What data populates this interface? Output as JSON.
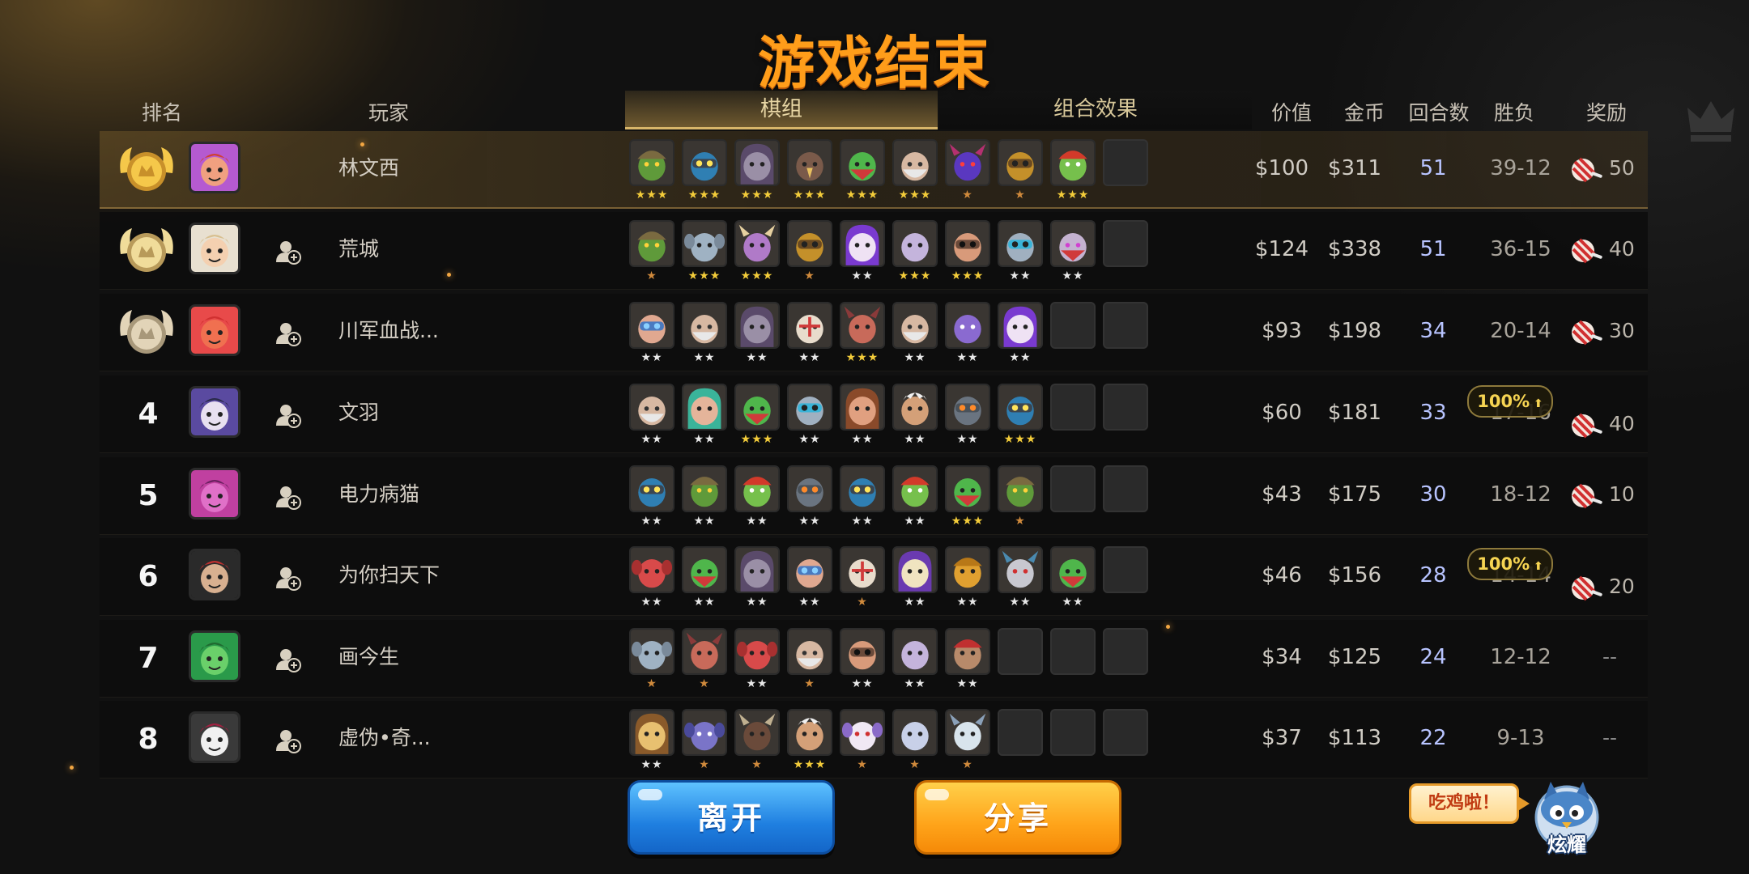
{
  "title": "游戏结束",
  "headers": {
    "rank": "排名",
    "player": "玩家",
    "lineup_tab": "棋组",
    "synergy_tab": "组合效果",
    "value": "价值",
    "gold": "金币",
    "rounds": "回合数",
    "win_loss": "胜负",
    "reward": "奖励"
  },
  "players": [
    {
      "rank": "1",
      "name": "林文西",
      "value": "$100",
      "gold": "$311",
      "rounds": "51",
      "win_loss": "39-12",
      "reward_count": "50",
      "bonus": "",
      "units": [
        {
          "face": "goblin-helm",
          "stars": 3
        },
        {
          "face": "robot-goblin",
          "stars": 3
        },
        {
          "face": "hooded-grey",
          "stars": 3
        },
        {
          "face": "eagle",
          "stars": 3
        },
        {
          "face": "green-bandit",
          "stars": 3
        },
        {
          "face": "old-white",
          "stars": 3
        },
        {
          "face": "purple-horn",
          "stars": 1
        },
        {
          "face": "owl-goggles",
          "stars": 1
        },
        {
          "face": "green-redcap",
          "stars": 3
        },
        {
          "face": "empty",
          "stars": 0
        }
      ]
    },
    {
      "rank": "2",
      "name": "荒城",
      "value": "$124",
      "gold": "$338",
      "rounds": "51",
      "win_loss": "36-15",
      "reward_count": "40",
      "bonus": "",
      "units": [
        {
          "face": "goblin-helm",
          "stars": 1
        },
        {
          "face": "grey-beast",
          "stars": 3
        },
        {
          "face": "horned-beast",
          "stars": 3
        },
        {
          "face": "owl-goggles",
          "stars": 1
        },
        {
          "face": "purple-hair",
          "stars": 2
        },
        {
          "face": "ghost",
          "stars": 3
        },
        {
          "face": "bear-shades",
          "stars": 3
        },
        {
          "face": "cyan-robot",
          "stars": 2
        },
        {
          "face": "alien-mask",
          "stars": 2
        },
        {
          "face": "empty",
          "stars": 0
        }
      ]
    },
    {
      "rank": "3",
      "name": "川军血战...",
      "value": "$93",
      "gold": "$198",
      "rounds": "34",
      "win_loss": "20-14",
      "reward_count": "30",
      "bonus": "",
      "units": [
        {
          "face": "goggle-dwarf",
          "stars": 2
        },
        {
          "face": "old-white",
          "stars": 2
        },
        {
          "face": "hooded-grey",
          "stars": 2
        },
        {
          "face": "masked-knight",
          "stars": 2
        },
        {
          "face": "horned-mask",
          "stars": 3
        },
        {
          "face": "old-white",
          "stars": 2
        },
        {
          "face": "purple-ghoul",
          "stars": 2
        },
        {
          "face": "purple-hair",
          "stars": 2
        },
        {
          "face": "empty",
          "stars": 0
        },
        {
          "face": "empty",
          "stars": 0
        }
      ]
    },
    {
      "rank": "4",
      "name": "文羽",
      "value": "$60",
      "gold": "$181",
      "rounds": "33",
      "win_loss": "17-16",
      "reward_count": "40",
      "bonus": "100%",
      "units": [
        {
          "face": "old-white",
          "stars": 2
        },
        {
          "face": "teal-elf",
          "stars": 2
        },
        {
          "face": "green-bandit",
          "stars": 3
        },
        {
          "face": "cyan-robot",
          "stars": 2
        },
        {
          "face": "tribal-girl",
          "stars": 2
        },
        {
          "face": "feather-chief",
          "stars": 2
        },
        {
          "face": "stone-golem",
          "stars": 2
        },
        {
          "face": "robot-goblin",
          "stars": 3
        },
        {
          "face": "empty",
          "stars": 0
        },
        {
          "face": "empty",
          "stars": 0
        }
      ]
    },
    {
      "rank": "5",
      "name": "电力病猫",
      "value": "$43",
      "gold": "$175",
      "rounds": "30",
      "win_loss": "18-12",
      "reward_count": "10",
      "bonus": "",
      "units": [
        {
          "face": "robot-goblin",
          "stars": 2
        },
        {
          "face": "goblin-helm",
          "stars": 2
        },
        {
          "face": "green-redcap",
          "stars": 2
        },
        {
          "face": "stone-golem",
          "stars": 2
        },
        {
          "face": "robot-goblin",
          "stars": 2
        },
        {
          "face": "green-redcap",
          "stars": 2
        },
        {
          "face": "green-bandit",
          "stars": 3
        },
        {
          "face": "goblin-helm",
          "stars": 1
        },
        {
          "face": "empty",
          "stars": 0
        },
        {
          "face": "empty",
          "stars": 0
        }
      ]
    },
    {
      "rank": "6",
      "name": "为你扫天下",
      "value": "$46",
      "gold": "$156",
      "rounds": "28",
      "win_loss": "14-14",
      "reward_count": "20",
      "bonus": "100%",
      "units": [
        {
          "face": "red-beast",
          "stars": 2
        },
        {
          "face": "green-bandit",
          "stars": 2
        },
        {
          "face": "hooded-grey",
          "stars": 2
        },
        {
          "face": "goggle-dwarf",
          "stars": 2
        },
        {
          "face": "masked-knight",
          "stars": 1
        },
        {
          "face": "hooded-mage",
          "stars": 2
        },
        {
          "face": "golden-helm",
          "stars": 2
        },
        {
          "face": "grey-demon",
          "stars": 2
        },
        {
          "face": "green-bandit",
          "stars": 2
        },
        {
          "face": "empty",
          "stars": 0
        }
      ]
    },
    {
      "rank": "7",
      "name": "画今生",
      "value": "$34",
      "gold": "$125",
      "rounds": "24",
      "win_loss": "12-12",
      "reward_count": "--",
      "bonus": "",
      "units": [
        {
          "face": "grey-beast",
          "stars": 1
        },
        {
          "face": "horned-mask",
          "stars": 1
        },
        {
          "face": "red-beast",
          "stars": 2
        },
        {
          "face": "old-white",
          "stars": 1
        },
        {
          "face": "bear-shades",
          "stars": 2
        },
        {
          "face": "ghost",
          "stars": 2
        },
        {
          "face": "pirate",
          "stars": 2
        },
        {
          "face": "empty",
          "stars": 0
        },
        {
          "face": "empty",
          "stars": 0
        },
        {
          "face": "empty",
          "stars": 0
        }
      ]
    },
    {
      "rank": "8",
      "name": "虚伪•奇...",
      "value": "$37",
      "gold": "$113",
      "rounds": "22",
      "win_loss": "9-13",
      "reward_count": "--",
      "bonus": "",
      "units": [
        {
          "face": "lion",
          "stars": 2
        },
        {
          "face": "bat",
          "stars": 1
        },
        {
          "face": "ox",
          "stars": 1
        },
        {
          "face": "feather-chief",
          "stars": 3
        },
        {
          "face": "white-fox",
          "stars": 1
        },
        {
          "face": "yeti",
          "stars": 1
        },
        {
          "face": "snow-beast",
          "stars": 1
        },
        {
          "face": "empty",
          "stars": 0
        },
        {
          "face": "empty",
          "stars": 0
        },
        {
          "face": "empty",
          "stars": 0
        }
      ]
    }
  ],
  "buttons": {
    "leave": "离开",
    "share": "分享",
    "show_off": "炫耀"
  },
  "bubble": "吃鸡啦！",
  "colors": {
    "title": "#ff9d1a",
    "rounds": "#b8c4ff",
    "gold_star": "#f3cc3a",
    "silver_star": "#e8e8e8",
    "bronze_star": "#d08a3c"
  }
}
